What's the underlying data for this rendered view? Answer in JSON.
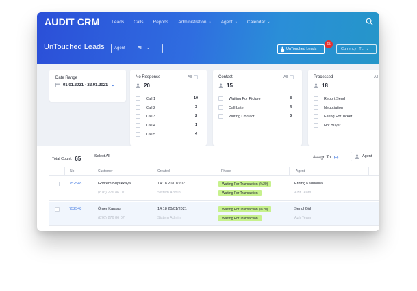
{
  "app": {
    "logo": "AUDIT CRM",
    "nav": [
      "Leads",
      "Calls",
      "Reports",
      "Administration",
      "Agent",
      "Calendar"
    ]
  },
  "toolbar": {
    "title": "UnTouched Leads",
    "agent_label": "Agent",
    "agent_value": "All",
    "untouched_label": "UnTouched Leads",
    "untouched_count": "65",
    "currency_label": "Currency",
    "currency_value": "TL"
  },
  "filters": {
    "date_label": "Date Range",
    "date_value": "01.01.2021 - 22.01.2021",
    "all_label": "All",
    "no_response": {
      "title": "No Response",
      "count": "20",
      "options": [
        {
          "label": "Call 1",
          "count": "10"
        },
        {
          "label": "Call 2",
          "count": "3"
        },
        {
          "label": "Call 3",
          "count": "2"
        },
        {
          "label": "Call 4",
          "count": "1"
        },
        {
          "label": "Call 5",
          "count": "4"
        }
      ]
    },
    "contact": {
      "title": "Contact",
      "count": "15",
      "options": [
        {
          "label": "Waiting For Picture",
          "count": "8"
        },
        {
          "label": "Call Later",
          "count": "4"
        },
        {
          "label": "Writing Contact",
          "count": "3"
        }
      ]
    },
    "processed": {
      "title": "Processed",
      "count": "18",
      "options": [
        {
          "label": "Report Send"
        },
        {
          "label": "Negotiation"
        },
        {
          "label": "Eating For Ticket"
        },
        {
          "label": "Hot Buyer"
        }
      ]
    }
  },
  "table": {
    "total_label": "Total Count:",
    "total_value": "65",
    "select_all": "Select All",
    "assign_to": "Assign To",
    "agent_label": "Agent",
    "columns": [
      "No",
      "Customer",
      "Created",
      "Phase",
      "Agent"
    ],
    "rows": [
      {
        "id": "752548",
        "customer": "Görkem Büyükkaya",
        "phone": "(876) 276 86 07",
        "created": "14:18 20/01/2021",
        "created_by": "Sistem Admin",
        "phase1": "Waiting For Transaction (%20)",
        "phase2": "Waiting For Transaction",
        "agent": "Erdinç Kaddoura",
        "team": "Azlr Team"
      },
      {
        "id": "752548",
        "customer": "Ömer Karasu",
        "phone": "(876) 276 86 07",
        "created": "14:18 20/01/2021",
        "created_by": "Sistem Admin",
        "phase1": "Waiting For Transaction (%20)",
        "phase2": "Waiting For Transaction",
        "agent": "Şenol Gül",
        "team": "Azlr Team"
      }
    ]
  },
  "colors": {
    "brand_blue": "#2f6de0",
    "badge_red": "#e5302f",
    "phase_green": "#c7f18d",
    "link_blue": "#3b74e0"
  },
  "icons": {
    "search": "search-icon",
    "hand": "hand-pointer-icon",
    "person": "person-icon",
    "calendar": "calendar-icon"
  }
}
